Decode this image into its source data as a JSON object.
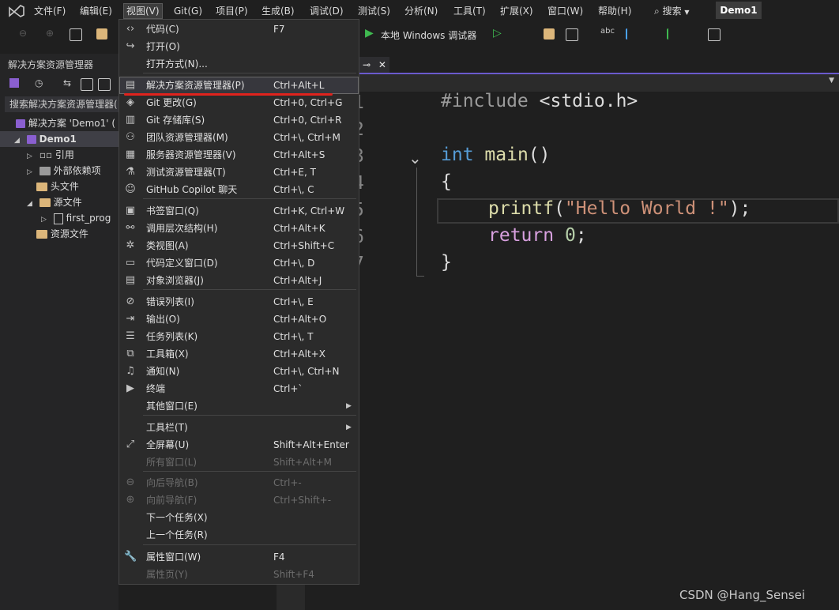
{
  "menubar": {
    "items": [
      "文件(F)",
      "编辑(E)",
      "视图(V)",
      "Git(G)",
      "项目(P)",
      "生成(B)",
      "调试(D)",
      "测试(S)",
      "分析(N)",
      "工具(T)",
      "扩展(X)",
      "窗口(W)",
      "帮助(H)"
    ],
    "search": "搜索",
    "project": "Demo1"
  },
  "toolbar": {
    "run_label": "本地 Windows 调试器"
  },
  "solution_explorer": {
    "title": "解决方案资源管理器",
    "search_placeholder": "搜索解决方案资源管理器(",
    "tree": [
      "解决方案 'Demo1' (",
      "Demo1",
      "引用",
      "外部依赖项",
      "头文件",
      "源文件",
      "first_prog",
      "资源文件"
    ]
  },
  "editor": {
    "line_numbers": [
      "1",
      "2",
      "3",
      "4",
      "5",
      "6",
      "7"
    ],
    "code": {
      "l1_pre": "#include",
      "l1_hdr": "<stdio.h>",
      "l3_kw": "int",
      "l3_fn": "main",
      "l3_paren": "()",
      "l4": "{",
      "l5_fn": "printf",
      "l5_open": "(",
      "l5_str": "\"Hello World !\"",
      "l5_close": ");",
      "l6_kw": "return",
      "l6_num": "0",
      "l6_semi": ";",
      "l7": "}"
    }
  },
  "view_menu": [
    {
      "icon": "code-icon",
      "glyph": "‹›",
      "label": "代码(C)",
      "shortcut": "F7"
    },
    {
      "icon": "open-icon",
      "glyph": "↪",
      "label": "打开(O)",
      "shortcut": ""
    },
    {
      "icon": "",
      "glyph": "",
      "label": "打开方式(N)...",
      "shortcut": ""
    },
    {
      "icon": "solution-explorer-icon",
      "glyph": "▤",
      "label": "解决方案资源管理器(P)",
      "shortcut": "Ctrl+Alt+L"
    },
    {
      "icon": "git-changes-icon",
      "glyph": "◈",
      "label": "Git 更改(G)",
      "shortcut": "Ctrl+0, Ctrl+G"
    },
    {
      "icon": "git-repo-icon",
      "glyph": "▥",
      "label": "Git 存储库(S)",
      "shortcut": "Ctrl+0, Ctrl+R"
    },
    {
      "icon": "team-icon",
      "glyph": "⚇",
      "label": "团队资源管理器(M)",
      "shortcut": "Ctrl+\\, Ctrl+M"
    },
    {
      "icon": "server-icon",
      "glyph": "▦",
      "label": "服务器资源管理器(V)",
      "shortcut": "Ctrl+Alt+S"
    },
    {
      "icon": "test-icon",
      "glyph": "⚗",
      "label": "测试资源管理器(T)",
      "shortcut": "Ctrl+E, T"
    },
    {
      "icon": "copilot-icon",
      "glyph": "☺",
      "label": "GitHub Copilot 聊天",
      "shortcut": "Ctrl+\\, C"
    },
    {
      "icon": "bookmark-icon",
      "glyph": "▣",
      "label": "书签窗口(Q)",
      "shortcut": "Ctrl+K, Ctrl+W"
    },
    {
      "icon": "call-hierarchy-icon",
      "glyph": "⚯",
      "label": "调用层次结构(H)",
      "shortcut": "Ctrl+Alt+K"
    },
    {
      "icon": "class-view-icon",
      "glyph": "✲",
      "label": "类视图(A)",
      "shortcut": "Ctrl+Shift+C"
    },
    {
      "icon": "code-definition-icon",
      "glyph": "▭",
      "label": "代码定义窗口(D)",
      "shortcut": "Ctrl+\\, D"
    },
    {
      "icon": "object-browser-icon",
      "glyph": "▤",
      "label": "对象浏览器(J)",
      "shortcut": "Ctrl+Alt+J"
    },
    {
      "icon": "error-list-icon",
      "glyph": "⊘",
      "label": "错误列表(I)",
      "shortcut": "Ctrl+\\, E"
    },
    {
      "icon": "output-icon",
      "glyph": "⇥",
      "label": "输出(O)",
      "shortcut": "Ctrl+Alt+O"
    },
    {
      "icon": "task-list-icon",
      "glyph": "☰",
      "label": "任务列表(K)",
      "shortcut": "Ctrl+\\, T"
    },
    {
      "icon": "toolbox-icon",
      "glyph": "⧉",
      "label": "工具箱(X)",
      "shortcut": "Ctrl+Alt+X"
    },
    {
      "icon": "notification-icon",
      "glyph": "♫",
      "label": "通知(N)",
      "shortcut": "Ctrl+\\, Ctrl+N"
    },
    {
      "icon": "terminal-icon",
      "glyph": "▶",
      "label": "终端",
      "shortcut": "Ctrl+`"
    },
    {
      "icon": "",
      "glyph": "",
      "label": "其他窗口(E)",
      "shortcut": ""
    },
    {
      "icon": "",
      "glyph": "",
      "label": "工具栏(T)",
      "shortcut": ""
    },
    {
      "icon": "fullscreen-icon",
      "glyph": "⤢",
      "label": "全屏幕(U)",
      "shortcut": "Shift+Alt+Enter"
    },
    {
      "icon": "",
      "glyph": "",
      "label": "所有窗口(L)",
      "shortcut": "Shift+Alt+M"
    },
    {
      "icon": "nav-back-icon",
      "glyph": "⊖",
      "label": "向后导航(B)",
      "shortcut": "Ctrl+-"
    },
    {
      "icon": "nav-forward-icon",
      "glyph": "⊕",
      "label": "向前导航(F)",
      "shortcut": "Ctrl+Shift+-"
    },
    {
      "icon": "",
      "glyph": "",
      "label": "下一个任务(X)",
      "shortcut": ""
    },
    {
      "icon": "",
      "glyph": "",
      "label": "上一个任务(R)",
      "shortcut": ""
    },
    {
      "icon": "wrench-icon",
      "glyph": "🔧",
      "label": "属性窗口(W)",
      "shortcut": "F4"
    },
    {
      "icon": "",
      "glyph": "",
      "label": "属性页(Y)",
      "shortcut": "Shift+F4"
    }
  ],
  "watermark": "CSDN @Hang_Sensei"
}
